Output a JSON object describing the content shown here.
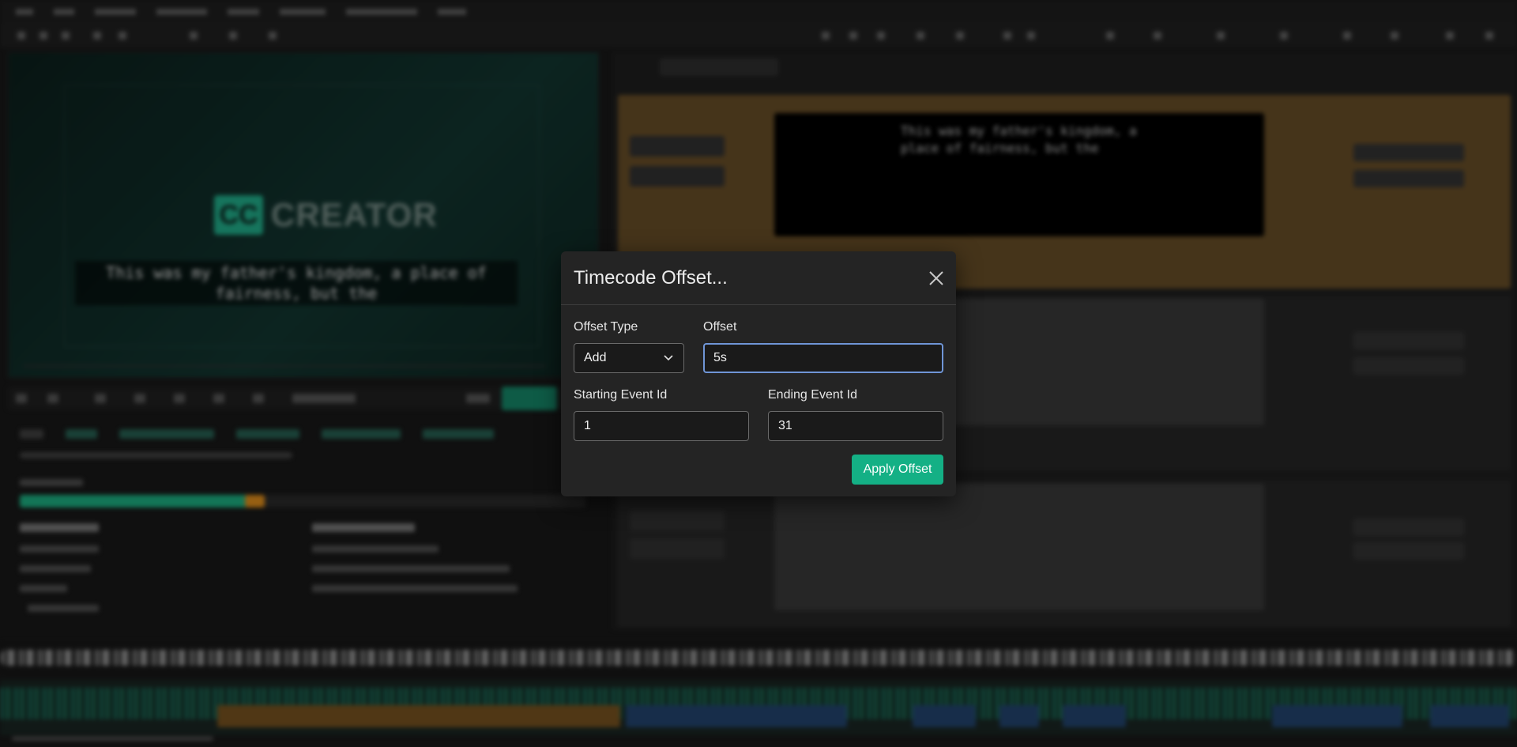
{
  "dialog": {
    "title": "Timecode Offset...",
    "offset_type_label": "Offset Type",
    "offset_type_value": "Add",
    "offset_label": "Offset",
    "offset_value": "5s",
    "start_label": "Starting Event Id",
    "start_value": "1",
    "end_label": "Ending Event Id",
    "end_value": "31",
    "apply_label": "Apply Offset"
  },
  "background": {
    "logo_cc": "CC",
    "logo_text": "CREATOR",
    "video_caption": "This was my father's kingdom, a place of fairness, but the",
    "event_caption": "This was my father's kingdom, a place of fairness, but the"
  },
  "colors": {
    "accent": "#14b085",
    "focus_border": "#6f95d6",
    "dialog_bg": "#242424"
  },
  "icons": {
    "close": "close-icon",
    "select": "chevron-down-icon"
  }
}
